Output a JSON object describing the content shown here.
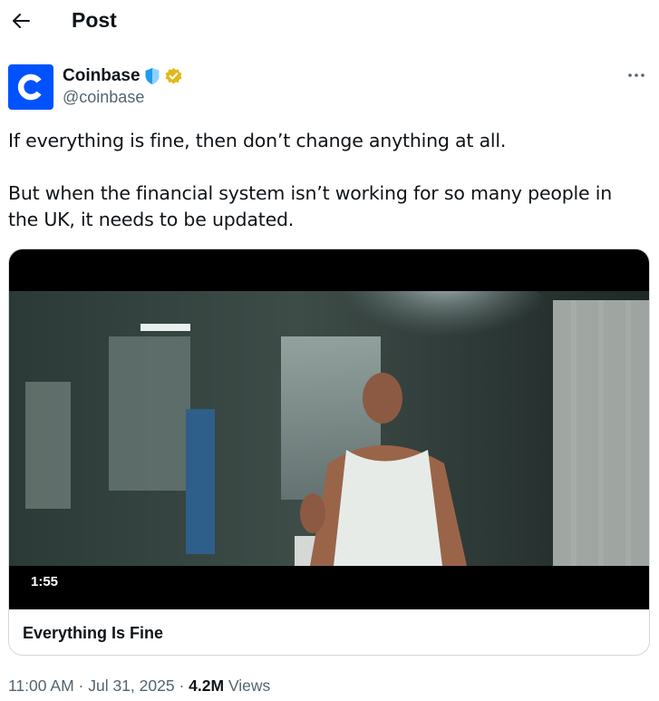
{
  "header": {
    "title": "Post"
  },
  "author": {
    "display_name": "Coinbase",
    "handle": "@coinbase"
  },
  "post": {
    "paragraphs": [
      "If everything is fine, then don’t change anything at all.",
      "But when the financial system isn’t working for so many people in the UK, it needs to be updated."
    ]
  },
  "media": {
    "duration": "1:55",
    "title": "Everything Is Fine"
  },
  "meta": {
    "time": "11:00 AM",
    "separator": "·",
    "date": "Jul 31, 2025",
    "views_count": "4.2M",
    "views_label": "Views"
  },
  "colors": {
    "brand": "#0052ff",
    "verified_gold": "#e2b719",
    "shield_blue": "#1d9bf0",
    "text_primary": "#0f1419",
    "text_secondary": "#536471"
  },
  "icons": {
    "back": "arrow-left-icon",
    "shield": "shield-icon",
    "verified": "verified-badge-icon",
    "more": "more-dots-icon"
  }
}
